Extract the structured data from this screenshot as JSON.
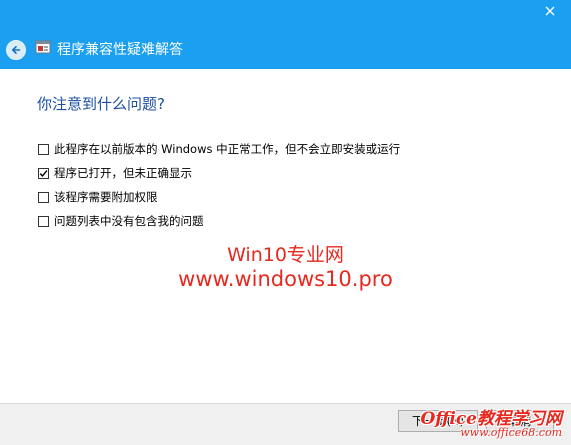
{
  "window": {
    "title": "程序兼容性疑难解答",
    "frame_color": "#1b9ff0"
  },
  "icons": {
    "back": "back-arrow-icon",
    "app": "compatibility-app-icon",
    "close": "close-icon",
    "check": "checkmark-icon"
  },
  "main": {
    "question": "你注意到什么问题?",
    "options": [
      {
        "label": "此程序在以前版本的 Windows 中正常工作，但不会立即安装或运行",
        "checked": false
      },
      {
        "label": "程序已打开，但未正确显示",
        "checked": true
      },
      {
        "label": "该程序需要附加权限",
        "checked": false
      },
      {
        "label": "问题列表中没有包含我的问题",
        "checked": false
      }
    ]
  },
  "watermark": {
    "line1": "Win10专业网",
    "line2": "www.windows10.pro",
    "color": "#e8281f"
  },
  "footer": {
    "next_label": "下一步(N)",
    "cancel_label": "取消",
    "logo_top": "Office教程学习网",
    "logo_bottom": "www.office68.com"
  }
}
